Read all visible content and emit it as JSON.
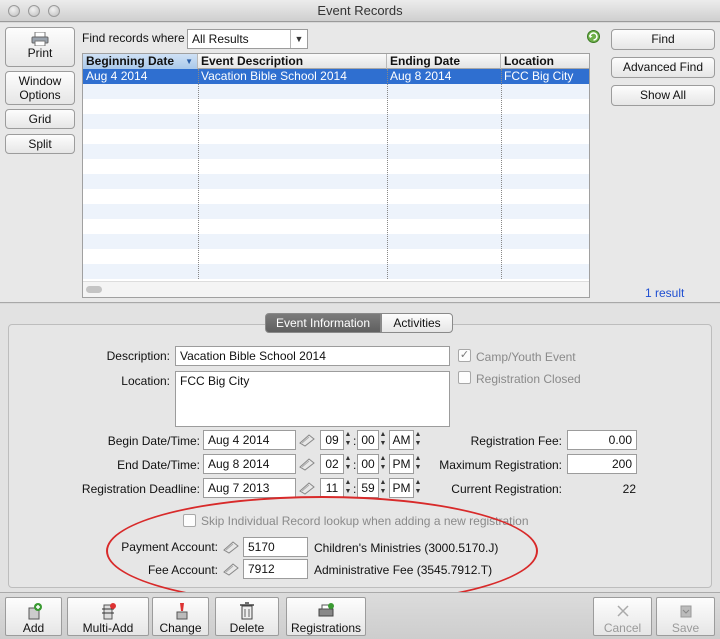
{
  "window": {
    "title": "Event Records"
  },
  "sidebar": {
    "print": "Print",
    "window_options": "Window\nOptions",
    "grid": "Grid",
    "split": "Split"
  },
  "find": {
    "label": "Find records where",
    "selected": "All Results"
  },
  "right_buttons": {
    "find": "Find",
    "advanced_find": "Advanced Find",
    "show_all": "Show All"
  },
  "table": {
    "columns": [
      "Beginning Date",
      "Event Description",
      "Ending Date",
      "Location"
    ],
    "rows": [
      [
        "Aug 4 2014",
        "Vacation Bible School 2014",
        "Aug 8 2014",
        "FCC Big City"
      ]
    ],
    "result_count": "1 result"
  },
  "tabs": {
    "event_information": "Event Information",
    "activities": "Activities"
  },
  "form": {
    "description_label": "Description:",
    "description": "Vacation Bible School 2014",
    "location_label": "Location:",
    "location": "FCC Big City",
    "camp_youth_label": "Camp/Youth Event",
    "registration_closed_label": "Registration Closed",
    "begin_label": "Begin Date/Time:",
    "begin_date": "Aug 4 2014",
    "begin_hour": "09",
    "begin_min": "00",
    "begin_ampm": "AM",
    "end_label": "End Date/Time:",
    "end_date": "Aug 8 2014",
    "end_hour": "02",
    "end_min": "00",
    "end_ampm": "PM",
    "deadline_label": "Registration Deadline:",
    "deadline_date": "Aug 7 2013",
    "deadline_hour": "11",
    "deadline_min": "59",
    "deadline_ampm": "PM",
    "reg_fee_label": "Registration Fee:",
    "reg_fee": "0.00",
    "max_reg_label": "Maximum Registration:",
    "max_reg": "200",
    "current_reg_label": "Current Registration:",
    "current_reg": "22",
    "skip_label": "Skip Individual Record lookup when adding a new registration",
    "payment_label": "Payment Account:",
    "payment_account": "5170",
    "payment_desc": "Children's Ministries (3000.5170.J)",
    "fee_label": "Fee Account:",
    "fee_account": "7912",
    "fee_desc": "Administrative Fee (3545.7912.T)",
    "colon": ":"
  },
  "toolbar": {
    "add": "Add",
    "multi_add": "Multi-Add",
    "change": "Change",
    "delete": "Delete",
    "registrations": "Registrations",
    "cancel": "Cancel",
    "save": "Save"
  },
  "colors": {
    "selection": "#2f6fd0",
    "annotation": "#d82a2a",
    "link": "#1f4fd1"
  }
}
